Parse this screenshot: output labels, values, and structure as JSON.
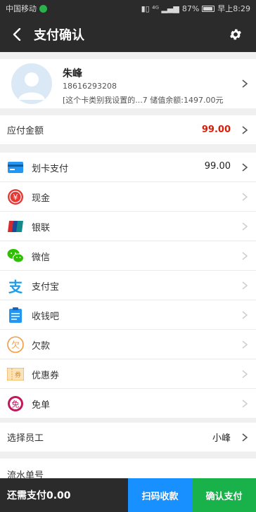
{
  "status_bar": {
    "carrier": "中国移动",
    "battery": "87%",
    "time": "早上8:29"
  },
  "header": {
    "title": "支付确认"
  },
  "member": {
    "name": "朱峰",
    "phone": "18616293208",
    "info": "[这个卡类别我设置的...7 储值余额:1497.00元"
  },
  "amount_due": {
    "label": "应付金额",
    "value": "99.00"
  },
  "payment_methods": [
    {
      "label": "划卡支付",
      "value": "99.00",
      "icon": "card-icon"
    },
    {
      "label": "现金",
      "value": "",
      "icon": "cash-icon"
    },
    {
      "label": "银联",
      "value": "",
      "icon": "unionpay-icon"
    },
    {
      "label": "微信",
      "value": "",
      "icon": "wechat-icon"
    },
    {
      "label": "支付宝",
      "value": "",
      "icon": "alipay-icon"
    },
    {
      "label": "收钱吧",
      "value": "",
      "icon": "shouqianba-icon"
    },
    {
      "label": "欠款",
      "value": "",
      "icon": "debt-icon"
    },
    {
      "label": "优惠券",
      "value": "",
      "icon": "coupon-icon"
    },
    {
      "label": "免单",
      "value": "",
      "icon": "free-order-icon"
    }
  ],
  "staff": {
    "label": "选择员工",
    "value": "小峰"
  },
  "serial": {
    "label": "流水单号"
  },
  "footer": {
    "remaining": "还需支付0.00",
    "scan_label": "扫码收款",
    "confirm_label": "确认支付"
  },
  "colors": {
    "header_bg": "#2b2b2b",
    "amount_red": "#d81e06",
    "scan_blue": "#1890ff",
    "confirm_green": "#19b24a"
  }
}
